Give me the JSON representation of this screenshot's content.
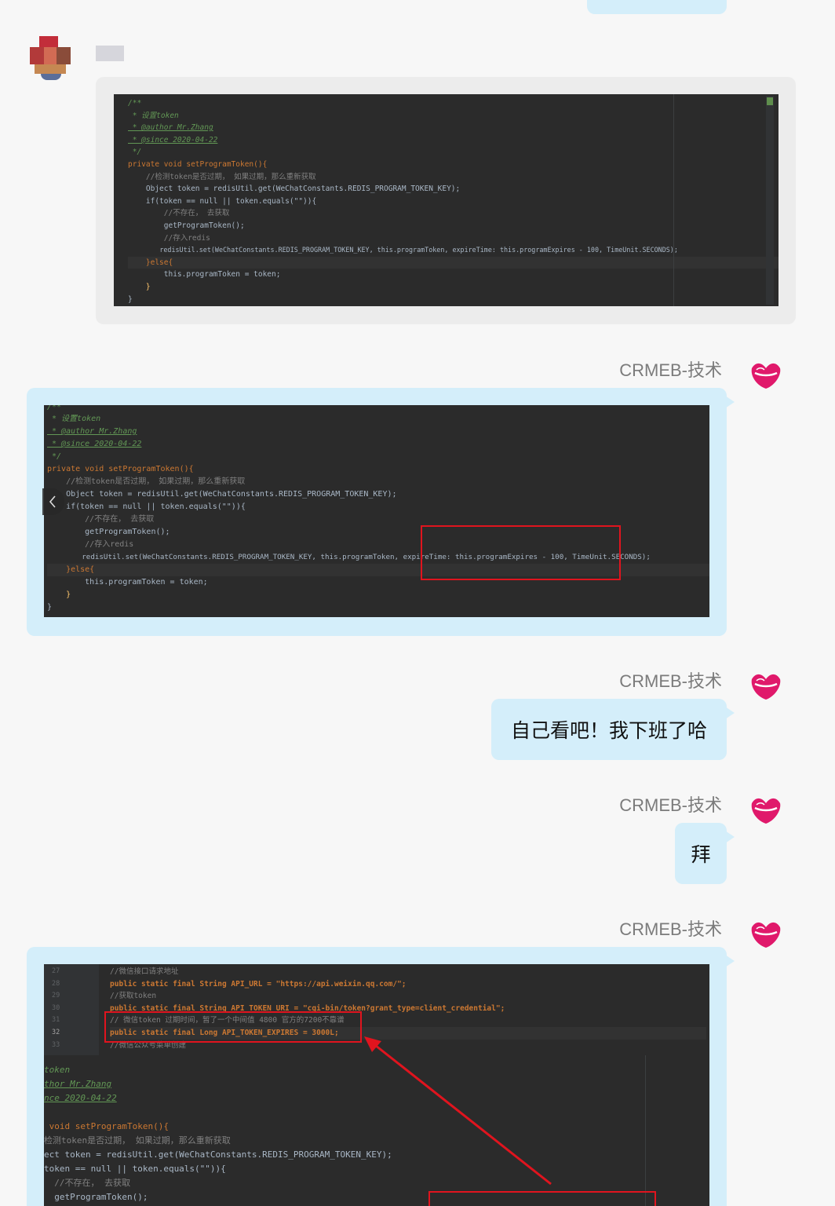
{
  "sender_name": "CRMEB-技术",
  "messages": {
    "text1": "自己看吧！我下班了哈",
    "text2": "拜"
  },
  "code_snippet": {
    "lines": [
      "/**",
      " * 设置token",
      " * @author Mr.Zhang",
      " * @since 2020-04-22",
      " */",
      "private void setProgramToken(){",
      "    //检测token是否过期， 如果过期，那么重新获取",
      "    Object token = redisUtil.get(WeChatConstants.REDIS_PROGRAM_TOKEN_KEY);",
      "    if(token == null || token.equals(\"\")){",
      "        //不存在， 去获取",
      "        getProgramToken();",
      "        //存入redis",
      "        redisUtil.set(WeChatConstants.REDIS_PROGRAM_TOKEN_KEY, this.programToken, expireTime: this.programExpires - 100, TimeUnit.SECONDS);",
      "    }else{",
      "        this.programToken = token;",
      "    }",
      "}"
    ],
    "hint_label": "expireTime:"
  },
  "constants_snippet": {
    "line_numbers": [
      "27",
      "28",
      "29",
      "30",
      "31",
      "32",
      "33"
    ],
    "lines": [
      "//微信接口请求地址",
      "public static final String API_URL = \"https://api.weixin.qq.com/\";",
      "//获取token",
      "public static final String API_TOKEN_URI = \"cgi-bin/token?grant_type=client_credential\";",
      "// 微信token 过期时间，暂了一个中间值 4800 官方的7200不靠谱",
      "public static final Long API_TOKEN_EXPIRES = 3000L;",
      "//微信公众号菜单创建"
    ]
  },
  "partial_snippet": {
    "lines": [
      "token",
      "thor Mr.Zhang",
      "nce 2020-04-22",
      "",
      " void setProgramToken(){",
      "检测token是否过期， 如果过期，那么重新获取",
      "ect token = redisUtil.get(WeChatConstants.REDIS_PROGRAM_TOKEN_KEY);",
      "token == null || token.equals(\"\")){",
      "  //不存在， 去获取",
      "  getProgramToken();"
    ]
  },
  "colors": {
    "bubble_right": "#d4eefa",
    "bubble_left": "#ececec",
    "annotation_red": "#e0141e"
  },
  "icons": {
    "sender_avatar": "lips-icon",
    "prev_nav": "chevron-left-icon"
  }
}
